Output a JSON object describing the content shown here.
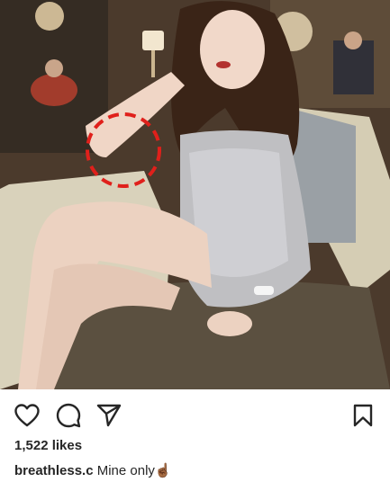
{
  "post": {
    "likes_text": "1,522 likes",
    "username": "breathless.c",
    "caption_text": "Mine only",
    "caption_emoji": "☝🏾"
  },
  "photo": {
    "annotation": "red dashed circle highlighting elbow",
    "annotation_color": "#e0201b"
  },
  "icons": {
    "like": "heart-icon",
    "comment": "comment-icon",
    "share": "send-icon",
    "save": "bookmark-icon"
  }
}
